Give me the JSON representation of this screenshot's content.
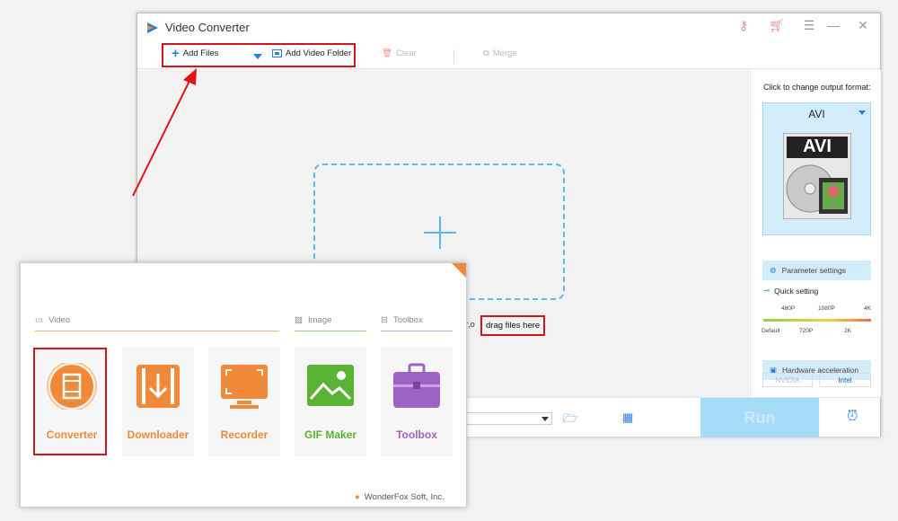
{
  "window": {
    "title": "Video Converter"
  },
  "toolbar": {
    "add_files": "Add Files",
    "add_video_folder": "Add Video Folder",
    "clear": "Clear",
    "merge": "Merge"
  },
  "drop_zone": {
    "hint_partial": "er,o",
    "drag_hint": "drag files here"
  },
  "right_panel": {
    "change_format_label": "Click to change output format:",
    "format_name": "AVI",
    "format_logo_text": "AVI",
    "parameter_settings": "Parameter settings",
    "quick_setting": "Quick setting",
    "quality_top_ticks": [
      "480P",
      "1080P",
      "4K"
    ],
    "quality_bottom_ticks": [
      "Default",
      "720P",
      "2K"
    ],
    "hardware_acceleration": "Hardware acceleration",
    "nvidia": "NVIDIA",
    "intel": "Intel"
  },
  "bottom_bar": {
    "run": "Run"
  },
  "launcher": {
    "categories": {
      "video": "Video",
      "image": "Image",
      "toolbox": "Toolbox"
    },
    "tiles": [
      {
        "label": "Converter",
        "color": "#f08a3a"
      },
      {
        "label": "Downloader",
        "color": "#f08a3a"
      },
      {
        "label": "Recorder",
        "color": "#f08a3a"
      },
      {
        "label": "GIF Maker",
        "color": "#5cb233"
      },
      {
        "label": "Toolbox",
        "color": "#9c62c4"
      }
    ],
    "brand": "WonderFox Soft, Inc."
  },
  "colors": {
    "accent_blue": "#2a7de1",
    "highlight_red": "#d0161b",
    "orange": "#f08a3a",
    "green": "#5cb233",
    "purple": "#9c62c4"
  }
}
